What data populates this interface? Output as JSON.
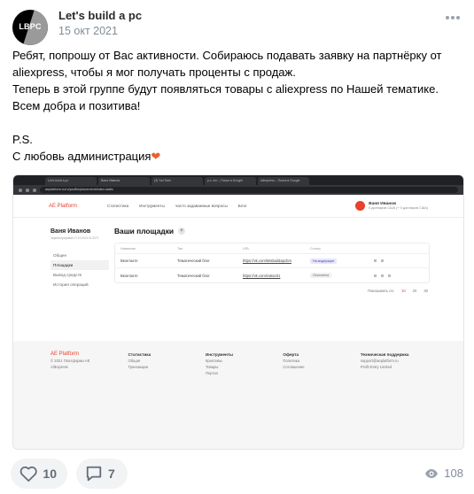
{
  "post": {
    "avatar_text": "LBPC",
    "author": "Let's build a pc",
    "date": "15 окт 2021",
    "lines": [
      "Ребят, попрошу от Вас активности. Собираюсь подавать заявку на партнёрку от",
      "aliexpress, чтобы я мог получать проценты с продаж.",
      "Теперь в этой группе будут появляться товары с aliexpress по Нашей тематике.",
      "Всем добра и позитива!",
      "",
      "P.S.",
      "С любовь администрация"
    ],
    "emoji": "❤"
  },
  "screenshot": {
    "tabs": [
      "Let's build a pc",
      "Ваня Иванов",
      "(3) YouTube",
      "p.c. inn – Поиск в Google",
      "aliexpress – Поиск в Google"
    ],
    "url": "aeplatform.ru/ru/profile/placement/index-static",
    "header": {
      "logo": "AE Platform",
      "menu": [
        "Статистика",
        "Инструменты",
        "часто задаваемые вопросы",
        "Блог"
      ],
      "user_name": "Ваня Иванов",
      "user_balance": "0 долларов США (+ 0 долларов США)"
    },
    "side": {
      "name": "Ваня Иванов",
      "meta": "Зарегистрирован 17.10.2021 ID 3171",
      "items": [
        "Общее",
        "Площадки",
        "Вывод средств",
        "История операций"
      ],
      "active_index": 1
    },
    "main": {
      "title": "Ваши площадки",
      "plus": "+",
      "columns": [
        "Название",
        "Тип",
        "URL",
        "Статус"
      ],
      "rows": [
        {
          "name": "Вконтакте",
          "type": "Тематический блог",
          "url": "https://vk.com/letsbuildapcbm",
          "status": "На модерации",
          "status_kind": "pending"
        },
        {
          "name": "Вконтакте",
          "type": "Тематический блог",
          "url": "https://vk.com/ratrac01",
          "status": "Отклонена",
          "status_kind": "declined"
        }
      ],
      "pager_label": "Показывать по:",
      "pager_options": [
        "10",
        "20",
        "30"
      ],
      "pager_selected": "10"
    },
    "footer": {
      "col1": {
        "logo": "AE Platform",
        "lines": [
          "© 2021 Платформа AE",
          "AliExpress"
        ]
      },
      "col2": {
        "title": "Статистика",
        "lines": [
          "Общая",
          "Транзакции"
        ]
      },
      "col3": {
        "title": "Инструменты",
        "lines": [
          "Креативы",
          "Товары",
          "Портал"
        ]
      },
      "col4": {
        "title": "Оферта",
        "lines": [
          "Политика",
          "Соглашение"
        ]
      },
      "col5": {
        "title": "Техническая поддержка",
        "lines": [
          "support@aeplatform.ru",
          "Profit Entry Limited"
        ]
      }
    }
  },
  "reactions": {
    "likes": "10",
    "comments": "7",
    "views": "108"
  }
}
